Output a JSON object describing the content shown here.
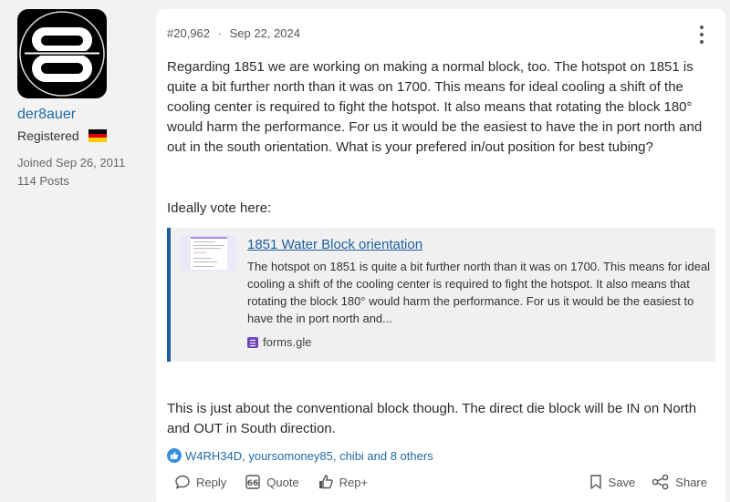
{
  "author": {
    "username": "der8auer",
    "role": "Registered",
    "country_flag": "germany-flag",
    "joined": "Joined Sep 26, 2011",
    "posts": "114 Posts"
  },
  "post": {
    "number": "#20,962",
    "separator": "·",
    "date": "Sep 22, 2024",
    "paragraph1": "Regarding 1851 we are working on making a normal block, too. The hotspot on 1851 is quite a bit further north than it was on 1700. This means for ideal cooling a shift of the cooling center is required to fight the hotspot. It also means that rotating the block 180° would harm the performance. For us it would be the easiest to have the in port north and out in the south orientation. What is your prefered in/out position for best tubing?",
    "paragraph2": "Ideally vote here:",
    "paragraph3": "This is just about the conventional block though. The direct die block will be IN on North and OUT in South direction.",
    "link_preview": {
      "title": "1851 Water Block orientation",
      "description": "The hotspot on 1851 is quite a bit further north than it was on 1700. This means for ideal cooling a shift of the cooling center is required to fight the hotspot. It also means that rotating the block 180° would harm the performance. For us it would be the easiest to have the in port north and...",
      "source": "forms.gle"
    },
    "reactions": "W4RH34D, yoursomoney85, chibi and 8 others"
  },
  "actions": {
    "reply": "Reply",
    "quote": "Quote",
    "rep": "Rep+",
    "save": "Save",
    "share": "Share"
  },
  "colors": {
    "link": "#1f6aa5",
    "accent_border": "#1f5f9f",
    "forms_icon": "#7248b9",
    "like_icon": "#3a8fe0"
  }
}
